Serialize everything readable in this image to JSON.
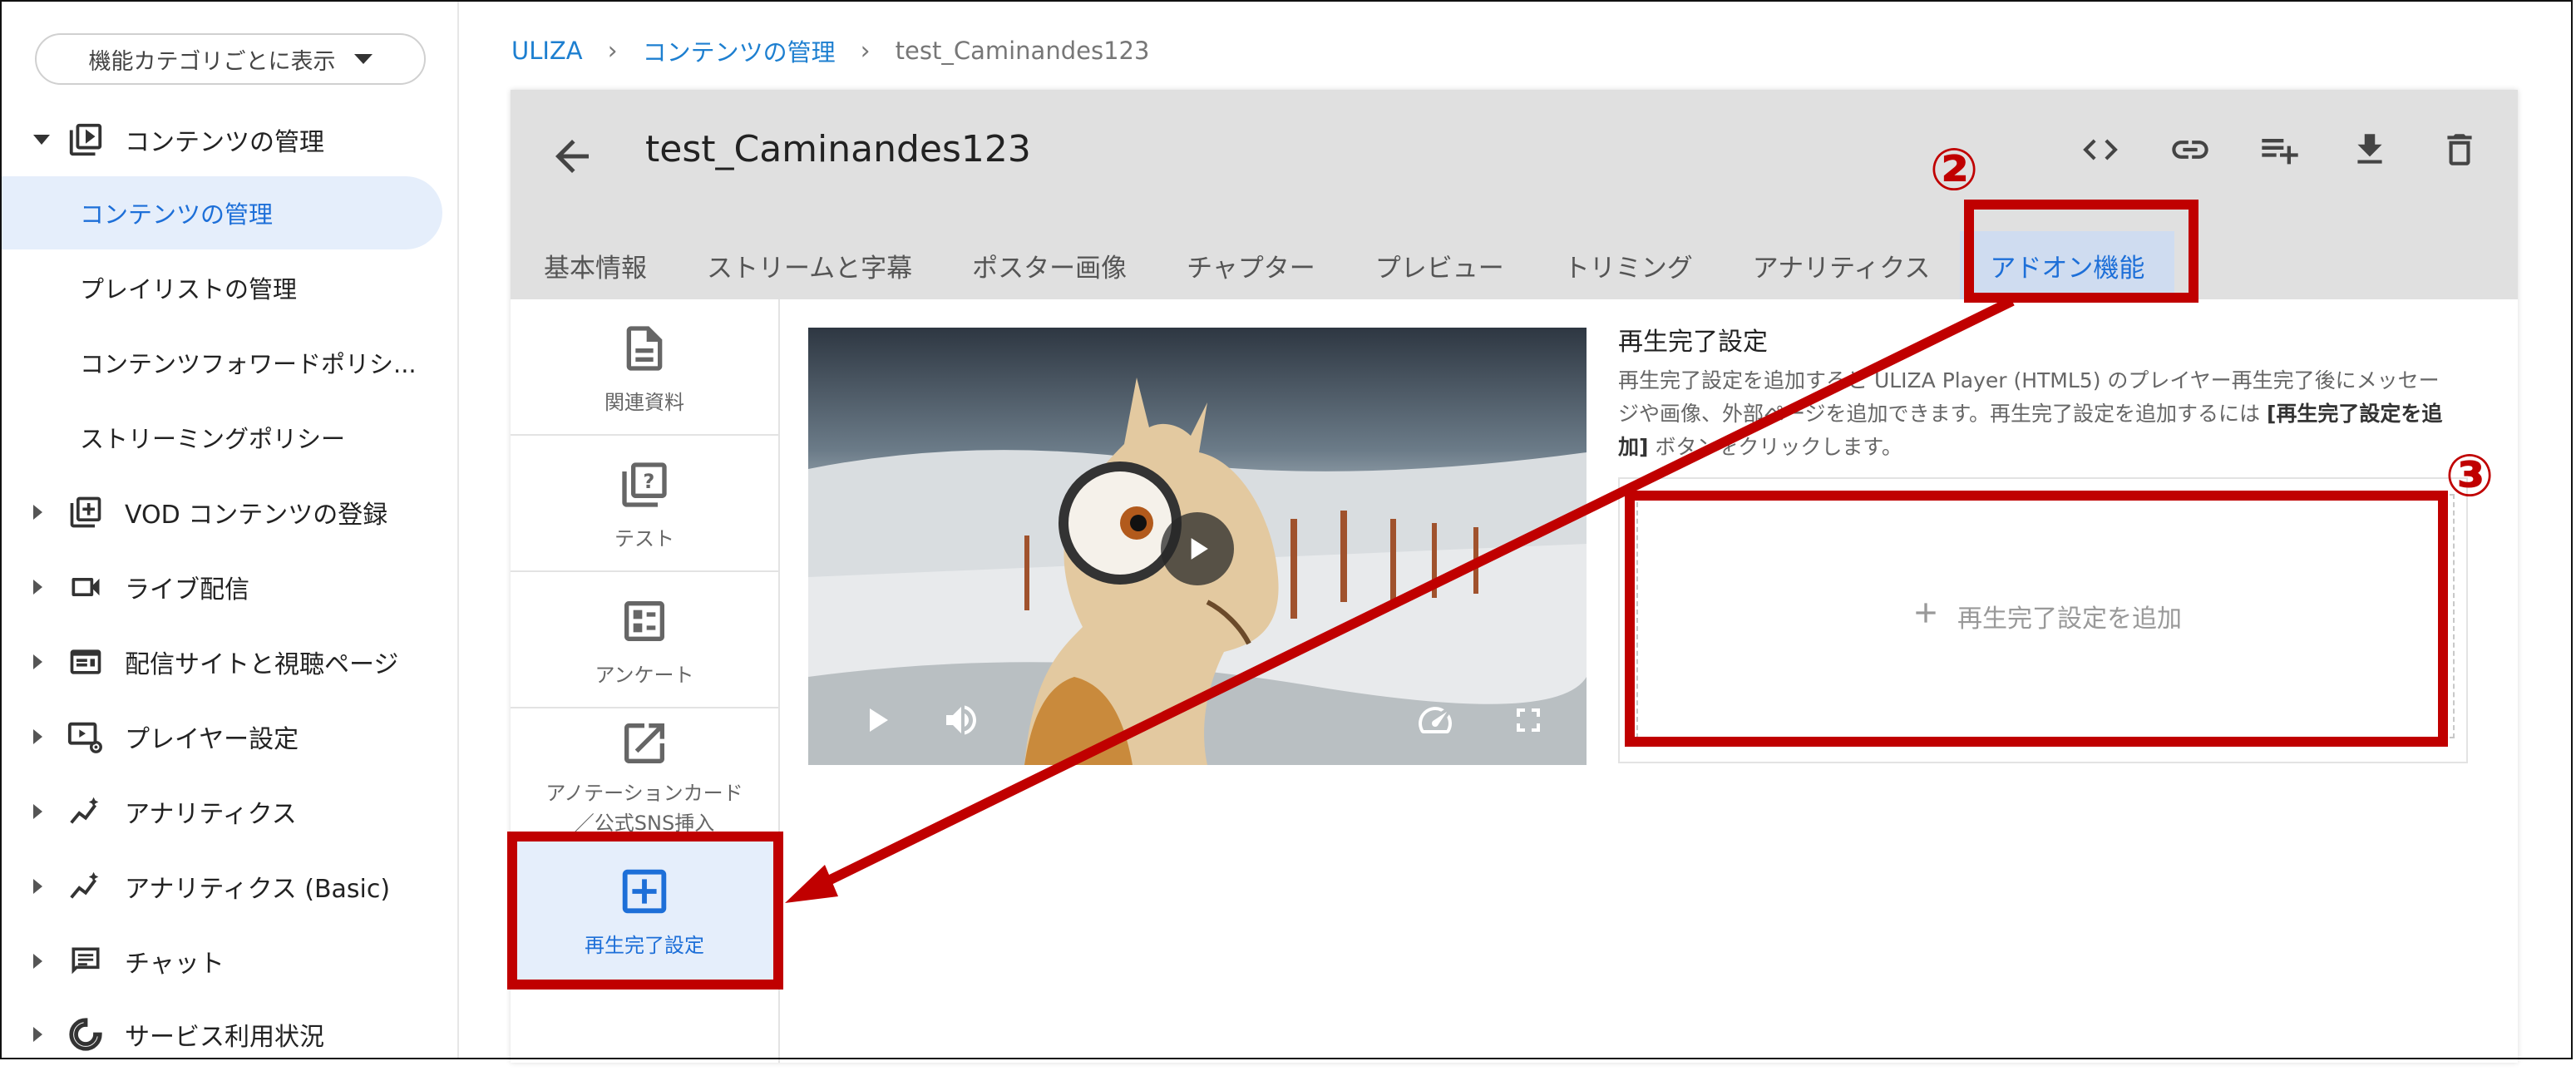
{
  "sidebar": {
    "filter_label": "機能カテゴリごとに表示",
    "groups": [
      {
        "label": "コンテンツの管理",
        "icon": "play-box-icon",
        "expanded": true
      },
      {
        "label": "VOD コンテンツの登録",
        "icon": "add-box-icon"
      },
      {
        "label": "ライブ配信",
        "icon": "camera-icon"
      },
      {
        "label": "配信サイトと視聴ページ",
        "icon": "site-icon"
      },
      {
        "label": "プレイヤー設定",
        "icon": "player-settings-icon"
      },
      {
        "label": "アナリティクス",
        "icon": "analytics-icon"
      },
      {
        "label": "アナリティクス (Basic)",
        "icon": "analytics-icon"
      },
      {
        "label": "チャット",
        "icon": "chat-icon"
      },
      {
        "label": "サービス利用状況",
        "icon": "usage-icon"
      }
    ],
    "subitems": [
      {
        "label": "コンテンツの管理",
        "active": true
      },
      {
        "label": "プレイリストの管理"
      },
      {
        "label": "コンテンツフォワードポリシ..."
      },
      {
        "label": "ストリーミングポリシー"
      }
    ]
  },
  "breadcrumb": [
    "ULIZA",
    "コンテンツの管理",
    "test_Caminandes123"
  ],
  "content": {
    "title": "test_Caminandes123",
    "tabs": [
      "基本情報",
      "ストリームと字幕",
      "ポスター画像",
      "チャプター",
      "プレビュー",
      "トリミング",
      "アナリティクス",
      "アドオン機能"
    ],
    "active_tab": "アドオン機能",
    "header_icons": [
      "code-icon",
      "link-icon",
      "playlist-add-icon",
      "download-icon",
      "delete-icon"
    ]
  },
  "addons": [
    {
      "label": "関連資料",
      "icon": "document-icon"
    },
    {
      "label": "テスト",
      "icon": "quiz-icon"
    },
    {
      "label": "アンケート",
      "icon": "survey-icon"
    },
    {
      "label": "アノテーションカード／公式SNS挿入",
      "icon": "external-link-icon"
    },
    {
      "label": "再生完了設定",
      "icon": "add-square-icon",
      "active": true
    }
  ],
  "settings": {
    "title": "再生完了設定",
    "desc_1": "再生完了設定を追加すると ULIZA Player (HTML5) のプレイヤー再生完了後にメッセージや画像、外部ページを追加できます。再生完了設定を追加するには ",
    "desc_bold": "[再生完了設定を追加]",
    "desc_2": " ボタンをクリックします。",
    "add_label": "再生完了設定を追加"
  },
  "annotations": {
    "marker_2": "②",
    "marker_3": "③",
    "color": "#c00000"
  }
}
